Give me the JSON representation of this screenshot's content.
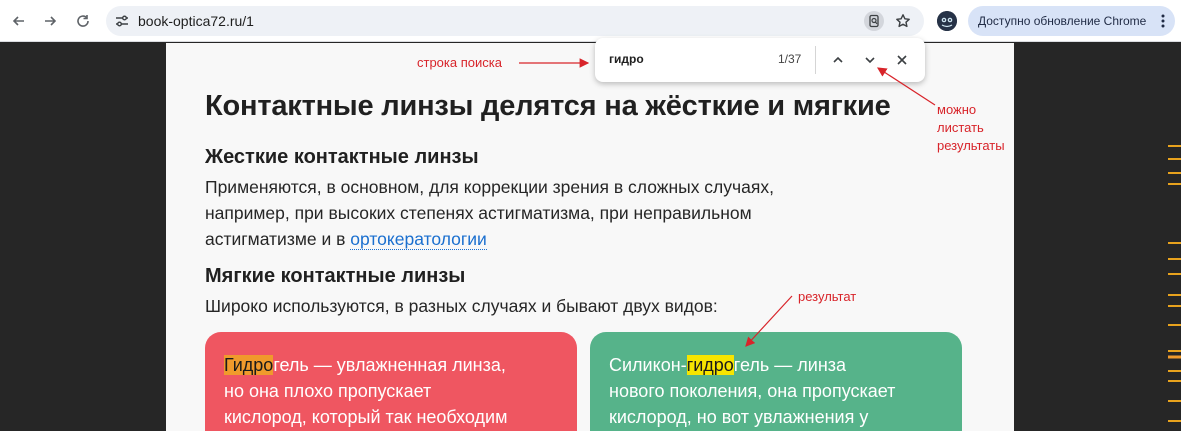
{
  "browser": {
    "url": "book-optica72.ru/1",
    "update_label": "Доступно обновление Chrome"
  },
  "find": {
    "query": "гидро",
    "count": "1/37"
  },
  "article": {
    "title": "Контактные линзы делятся на жёсткие и мягкие",
    "hard_heading": "Жесткие контактные линзы",
    "hard_line1": "Применяются, в основном, для коррекции зрения в сложных случаях,",
    "hard_line2": "например, при высоких степенях астигматизма, при неправильном",
    "hard_line3_prefix": "астигматизме и в ",
    "hard_link": "ортокератологии",
    "soft_heading": "Мягкие контактные линзы",
    "soft_text": "Широко используются, в разных случаях и бывают двух видов:",
    "card_red": {
      "highlight": "Гидро",
      "line1_rest": "гель — увлажненная линза,",
      "line2": "но она плохо пропускает",
      "line3": "кислород, который так необходим"
    },
    "card_green": {
      "prefix": "Силикон-",
      "highlight": "гидро",
      "line1_rest": "гель — линза",
      "line2": "нового поколения, она пропускает",
      "line3": "кислород, но вот увлажнения у"
    }
  },
  "annotations": {
    "search": "строка поиска",
    "scroll_line1": "можно",
    "scroll_line2": "листать",
    "scroll_line3": "результаты",
    "result": "результат"
  },
  "colors": {
    "annotation": "#d8242a",
    "current_match": "#f09a2c",
    "match": "#f7e500",
    "card_red": "#ef5661",
    "card_green": "#56b38a"
  }
}
